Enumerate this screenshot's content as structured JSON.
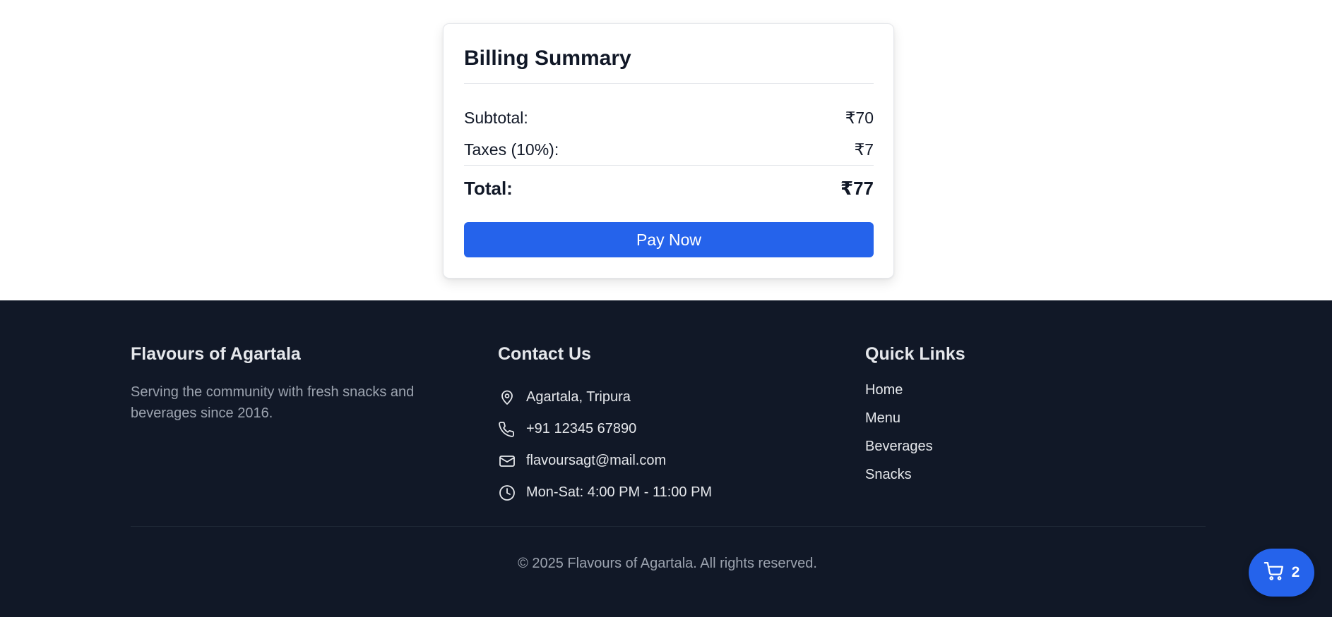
{
  "billing": {
    "title": "Billing Summary",
    "subtotal_label": "Subtotal:",
    "subtotal_value": "₹70",
    "taxes_label": "Taxes (10%):",
    "taxes_value": "₹7",
    "total_label": "Total:",
    "total_value": "₹77",
    "pay_button": "Pay Now"
  },
  "footer": {
    "about": {
      "heading": "Flavours of Agartala",
      "text": "Serving the community with fresh snacks and beverages since 2016."
    },
    "contact": {
      "heading": "Contact Us",
      "items": [
        {
          "icon": "map-pin-icon",
          "text": "Agartala, Tripura"
        },
        {
          "icon": "phone-icon",
          "text": "+91 12345 67890"
        },
        {
          "icon": "mail-icon",
          "text": "flavoursagt@mail.com"
        },
        {
          "icon": "clock-icon",
          "text": "Mon-Sat: 4:00 PM - 11:00 PM"
        }
      ]
    },
    "quick_links": {
      "heading": "Quick Links",
      "links": [
        "Home",
        "Menu",
        "Beverages",
        "Snacks"
      ]
    },
    "copyright": "© 2025 Flavours of Agartala. All rights reserved."
  },
  "cart": {
    "icon": "cart-icon",
    "count": "2"
  },
  "colors": {
    "accent": "#2563eb",
    "footer_bg": "#111827"
  }
}
